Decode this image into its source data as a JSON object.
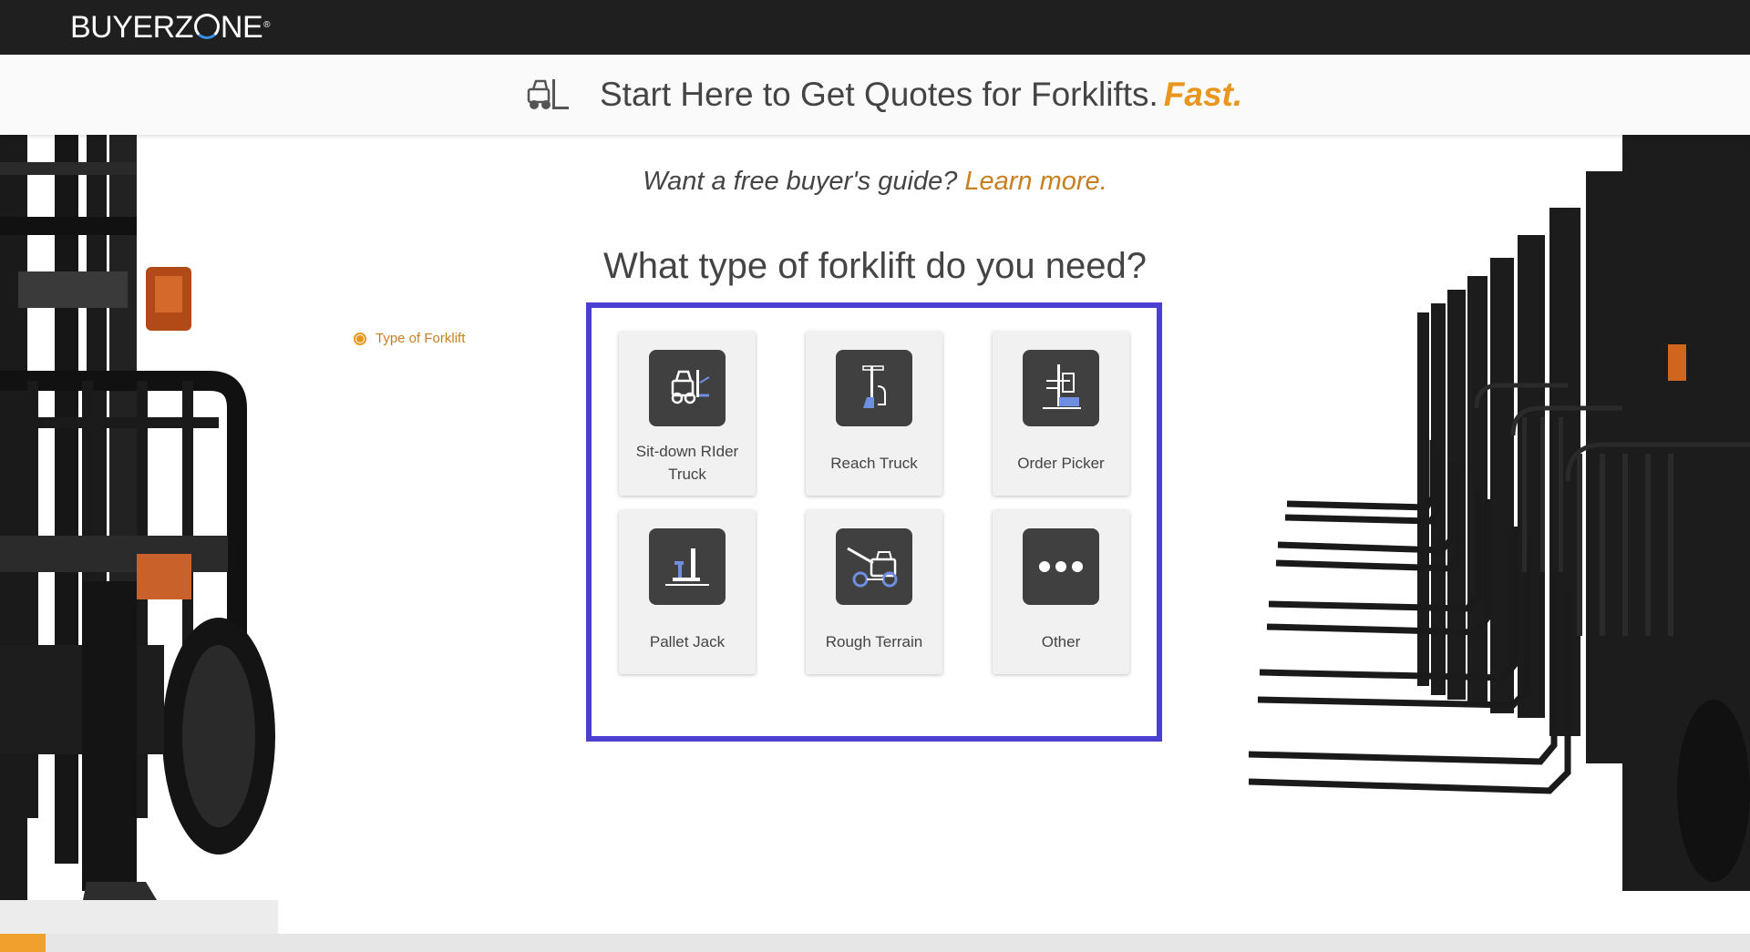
{
  "brand": {
    "logo_left": "BUYERZ",
    "logo_right": "NE",
    "logo_reg": "®"
  },
  "header": {
    "title": "Start Here to Get Quotes for Forklifts.",
    "accent": "Fast."
  },
  "guide": {
    "prompt": "Want a free buyer's guide?",
    "link": "Learn more."
  },
  "question": "What type of forklift do you need?",
  "progress": {
    "step_label": "Type of Forklift",
    "fraction": 0.026
  },
  "options": [
    {
      "label": "Sit-down RIder Truck",
      "icon": "sit-down-forklift-icon"
    },
    {
      "label": "Reach Truck",
      "icon": "reach-truck-icon"
    },
    {
      "label": "Order Picker",
      "icon": "order-picker-icon"
    },
    {
      "label": "Pallet Jack",
      "icon": "pallet-jack-icon"
    },
    {
      "label": "Rough Terrain",
      "icon": "rough-terrain-icon"
    },
    {
      "label": "Other",
      "icon": "more-icon"
    }
  ],
  "colors": {
    "accent": "#e8961e",
    "link": "#c8801e",
    "frame": "#4a3fd1",
    "topbar": "#1f1f1f",
    "icon_bg": "#404040",
    "icon_highlight": "#6e8fe0"
  }
}
